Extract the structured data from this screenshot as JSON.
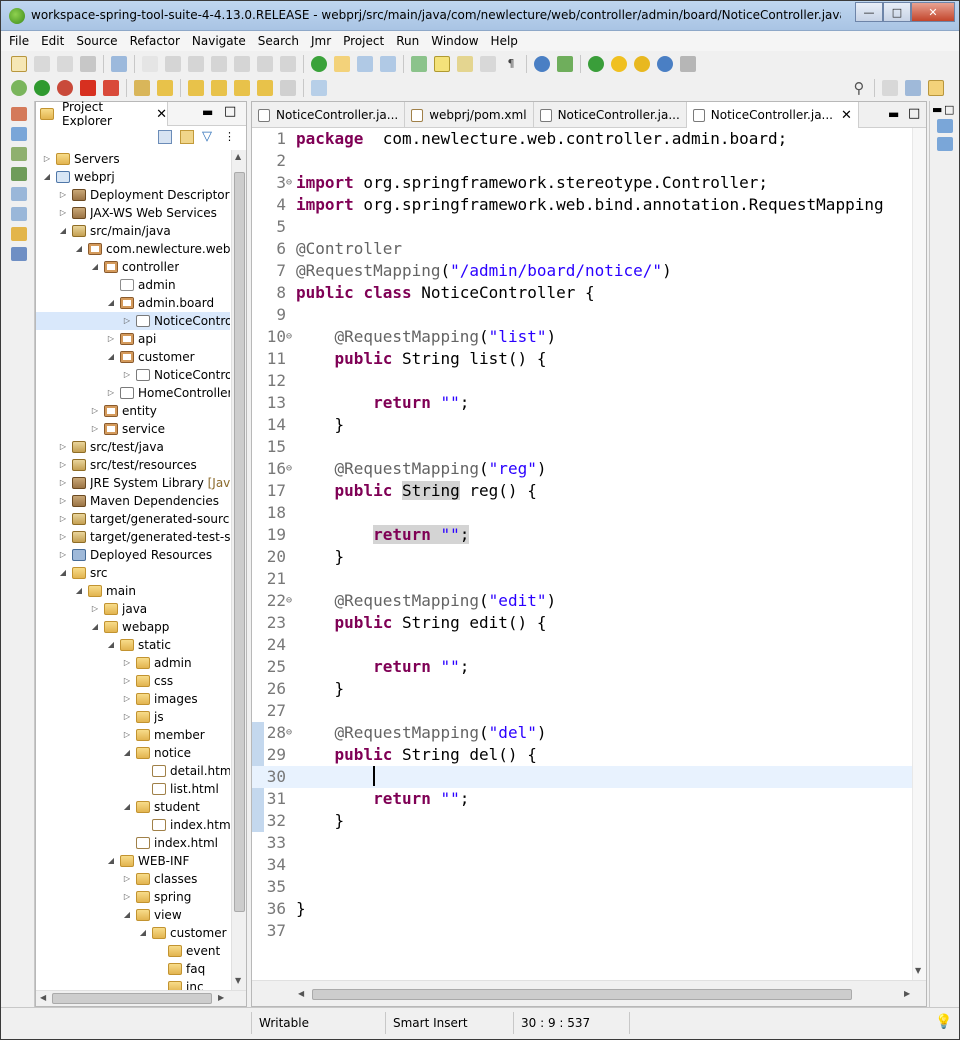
{
  "window": {
    "title": "workspace-spring-tool-suite-4-4.13.0.RELEASE - webprj/src/main/java/com/newlecture/web/controller/admin/board/NoticeController.java - Spring To...",
    "min_label": "—",
    "max_label": "□",
    "close_label": "✕"
  },
  "menu": [
    "File",
    "Edit",
    "Source",
    "Refactor",
    "Navigate",
    "Search",
    "Jmr",
    "Project",
    "Run",
    "Window",
    "Help"
  ],
  "explorer": {
    "tab_label": "Project Explorer",
    "tree": [
      {
        "label": "Servers",
        "indent": 0,
        "tw": "▷",
        "icon": "folder"
      },
      {
        "label": "webprj",
        "indent": 0,
        "tw": "◢",
        "icon": "proj"
      },
      {
        "label": "Deployment Descriptor: w",
        "indent": 1,
        "tw": "▷",
        "icon": "jar"
      },
      {
        "label": "JAX-WS Web Services",
        "indent": 1,
        "tw": "▷",
        "icon": "jar"
      },
      {
        "label": "src/main/java",
        "indent": 1,
        "tw": "◢",
        "icon": "srcf"
      },
      {
        "label": "com.newlecture.web",
        "indent": 2,
        "tw": "◢",
        "icon": "pkg"
      },
      {
        "label": "controller",
        "indent": 3,
        "tw": "◢",
        "icon": "pkg"
      },
      {
        "label": "admin",
        "indent": 4,
        "tw": "",
        "icon": "pkgempty"
      },
      {
        "label": "admin.board",
        "indent": 4,
        "tw": "◢",
        "icon": "pkg"
      },
      {
        "label": "NoticeControl",
        "indent": 5,
        "tw": "▷",
        "icon": "java",
        "selected": true
      },
      {
        "label": "api",
        "indent": 4,
        "tw": "▷",
        "icon": "pkg"
      },
      {
        "label": "customer",
        "indent": 4,
        "tw": "◢",
        "icon": "pkg"
      },
      {
        "label": "NoticeControl",
        "indent": 5,
        "tw": "▷",
        "icon": "java"
      },
      {
        "label": "HomeController.j",
        "indent": 4,
        "tw": "▷",
        "icon": "java"
      },
      {
        "label": "entity",
        "indent": 3,
        "tw": "▷",
        "icon": "pkg"
      },
      {
        "label": "service",
        "indent": 3,
        "tw": "▷",
        "icon": "pkg"
      },
      {
        "label": "src/test/java",
        "indent": 1,
        "tw": "▷",
        "icon": "srcf"
      },
      {
        "label": "src/test/resources",
        "indent": 1,
        "tw": "▷",
        "icon": "srcf"
      },
      {
        "label": "JRE System Library [JavaSE",
        "indent": 1,
        "tw": "▷",
        "icon": "jar",
        "muted_suffix": "[JavaSE"
      },
      {
        "label": "Maven Dependencies",
        "indent": 1,
        "tw": "▷",
        "icon": "jar"
      },
      {
        "label": "target/generated-sources/",
        "indent": 1,
        "tw": "▷",
        "icon": "srcf"
      },
      {
        "label": "target/generated-test-sour",
        "indent": 1,
        "tw": "▷",
        "icon": "srcf"
      },
      {
        "label": "Deployed Resources",
        "indent": 1,
        "tw": "▷",
        "icon": "server"
      },
      {
        "label": "src",
        "indent": 1,
        "tw": "◢",
        "icon": "folder"
      },
      {
        "label": "main",
        "indent": 2,
        "tw": "◢",
        "icon": "folder"
      },
      {
        "label": "java",
        "indent": 3,
        "tw": "▷",
        "icon": "folder"
      },
      {
        "label": "webapp",
        "indent": 3,
        "tw": "◢",
        "icon": "folder"
      },
      {
        "label": "static",
        "indent": 4,
        "tw": "◢",
        "icon": "folder"
      },
      {
        "label": "admin",
        "indent": 5,
        "tw": "▷",
        "icon": "folder"
      },
      {
        "label": "css",
        "indent": 5,
        "tw": "▷",
        "icon": "folder"
      },
      {
        "label": "images",
        "indent": 5,
        "tw": "▷",
        "icon": "folder"
      },
      {
        "label": "js",
        "indent": 5,
        "tw": "▷",
        "icon": "folder"
      },
      {
        "label": "member",
        "indent": 5,
        "tw": "▷",
        "icon": "folder"
      },
      {
        "label": "notice",
        "indent": 5,
        "tw": "◢",
        "icon": "folder"
      },
      {
        "label": "detail.html",
        "indent": 6,
        "tw": "",
        "icon": "html"
      },
      {
        "label": "list.html",
        "indent": 6,
        "tw": "",
        "icon": "html"
      },
      {
        "label": "student",
        "indent": 5,
        "tw": "◢",
        "icon": "folder"
      },
      {
        "label": "index.html",
        "indent": 6,
        "tw": "",
        "icon": "html"
      },
      {
        "label": "index.html",
        "indent": 5,
        "tw": "",
        "icon": "html"
      },
      {
        "label": "WEB-INF",
        "indent": 4,
        "tw": "◢",
        "icon": "folder"
      },
      {
        "label": "classes",
        "indent": 5,
        "tw": "▷",
        "icon": "folder"
      },
      {
        "label": "spring",
        "indent": 5,
        "tw": "▷",
        "icon": "folder"
      },
      {
        "label": "view",
        "indent": 5,
        "tw": "◢",
        "icon": "folder"
      },
      {
        "label": "customer",
        "indent": 6,
        "tw": "◢",
        "icon": "folder"
      },
      {
        "label": "event",
        "indent": 7,
        "tw": "",
        "icon": "folder"
      },
      {
        "label": "faq",
        "indent": 7,
        "tw": "",
        "icon": "folder"
      },
      {
        "label": "inc",
        "indent": 7,
        "tw": "",
        "icon": "folder"
      }
    ]
  },
  "editor": {
    "tabs": [
      {
        "label": "NoticeController.ja...",
        "icon": "java"
      },
      {
        "label": "webprj/pom.xml",
        "icon": "xml"
      },
      {
        "label": "NoticeController.ja...",
        "icon": "java"
      },
      {
        "label": "NoticeController.ja...",
        "icon": "java",
        "active": true,
        "closable": true
      }
    ],
    "close_glyph": "✕",
    "fold_glyph": "⊖",
    "current_line": 30,
    "lines": [
      {
        "n": "1",
        "tokens": [
          [
            "kw",
            "package"
          ],
          [
            "",
            "  com.newlecture.web.controller.admin.board;"
          ]
        ]
      },
      {
        "n": "2",
        "tokens": []
      },
      {
        "n": "3",
        "fold": true,
        "tokens": [
          [
            "kw",
            "import"
          ],
          [
            "",
            " org.springframework.stereotype.Controller;"
          ]
        ]
      },
      {
        "n": "4",
        "tokens": [
          [
            "kw",
            "import"
          ],
          [
            "",
            " org.springframework.web.bind.annotation.RequestMapping"
          ]
        ]
      },
      {
        "n": "5",
        "tokens": []
      },
      {
        "n": "6",
        "tokens": [
          [
            "an",
            "@Controller"
          ]
        ]
      },
      {
        "n": "7",
        "tokens": [
          [
            "an",
            "@RequestMapping"
          ],
          [
            "",
            "("
          ],
          [
            "st",
            "\"/admin/board/notice/\""
          ],
          [
            "",
            ")"
          ]
        ]
      },
      {
        "n": "8",
        "tokens": [
          [
            "kw",
            "public"
          ],
          [
            "",
            " "
          ],
          [
            "kw",
            "class"
          ],
          [
            "",
            " NoticeController {"
          ]
        ]
      },
      {
        "n": "9",
        "tokens": []
      },
      {
        "n": "10",
        "fold": true,
        "tokens": [
          [
            "",
            "    "
          ],
          [
            "an",
            "@RequestMapping"
          ],
          [
            "",
            "("
          ],
          [
            "st",
            "\"list\""
          ],
          [
            "",
            ")"
          ]
        ]
      },
      {
        "n": "11",
        "tokens": [
          [
            "",
            "    "
          ],
          [
            "kw",
            "public"
          ],
          [
            "",
            " String list() {"
          ]
        ]
      },
      {
        "n": "12",
        "tokens": []
      },
      {
        "n": "13",
        "tokens": [
          [
            "",
            "        "
          ],
          [
            "kw",
            "return"
          ],
          [
            "",
            " "
          ],
          [
            "st",
            "\"\""
          ],
          [
            "",
            ";"
          ]
        ]
      },
      {
        "n": "14",
        "tokens": [
          [
            "",
            "    }"
          ]
        ]
      },
      {
        "n": "15",
        "tokens": []
      },
      {
        "n": "16",
        "fold": true,
        "tokens": [
          [
            "",
            "    "
          ],
          [
            "an",
            "@RequestMapping"
          ],
          [
            "",
            "("
          ],
          [
            "st",
            "\"reg\""
          ],
          [
            "",
            ")"
          ]
        ]
      },
      {
        "n": "17",
        "tokens": [
          [
            "",
            "    "
          ],
          [
            "kw",
            "public"
          ],
          [
            "",
            " "
          ],
          [
            "hl",
            "String"
          ],
          [
            "",
            " reg() {"
          ]
        ]
      },
      {
        "n": "18",
        "tokens": []
      },
      {
        "n": "19",
        "tokens": [
          [
            "",
            "        "
          ],
          [
            "kw hl",
            "return"
          ],
          [
            "hl",
            " "
          ],
          [
            "st hl",
            "\"\""
          ],
          [
            "hl",
            ";"
          ]
        ]
      },
      {
        "n": "20",
        "tokens": [
          [
            "",
            "    }"
          ]
        ]
      },
      {
        "n": "21",
        "tokens": []
      },
      {
        "n": "22",
        "fold": true,
        "tokens": [
          [
            "",
            "    "
          ],
          [
            "an",
            "@RequestMapping"
          ],
          [
            "",
            "("
          ],
          [
            "st",
            "\"edit\""
          ],
          [
            "",
            ")"
          ]
        ]
      },
      {
        "n": "23",
        "tokens": [
          [
            "",
            "    "
          ],
          [
            "kw",
            "public"
          ],
          [
            "",
            " String edit() {"
          ]
        ]
      },
      {
        "n": "24",
        "tokens": []
      },
      {
        "n": "25",
        "tokens": [
          [
            "",
            "        "
          ],
          [
            "kw",
            "return"
          ],
          [
            "",
            " "
          ],
          [
            "st",
            "\"\""
          ],
          [
            "",
            ";"
          ]
        ]
      },
      {
        "n": "26",
        "tokens": [
          [
            "",
            "    }"
          ]
        ]
      },
      {
        "n": "27",
        "tokens": []
      },
      {
        "n": "28",
        "fold": true,
        "tokens": [
          [
            "",
            "    "
          ],
          [
            "an",
            "@RequestMapping"
          ],
          [
            "",
            "("
          ],
          [
            "st",
            "\"del\""
          ],
          [
            "",
            ")"
          ]
        ]
      },
      {
        "n": "29",
        "tokens": [
          [
            "",
            "    "
          ],
          [
            "kw",
            "public"
          ],
          [
            "",
            " String del() {"
          ]
        ]
      },
      {
        "n": "30",
        "caret": true,
        "tokens": [
          [
            "",
            "        "
          ]
        ]
      },
      {
        "n": "31",
        "tokens": [
          [
            "",
            "        "
          ],
          [
            "kw",
            "return"
          ],
          [
            "",
            " "
          ],
          [
            "st",
            "\"\""
          ],
          [
            "",
            ";"
          ]
        ]
      },
      {
        "n": "32",
        "tokens": [
          [
            "",
            "    }"
          ]
        ]
      },
      {
        "n": "33",
        "tokens": []
      },
      {
        "n": "34",
        "tokens": []
      },
      {
        "n": "35",
        "tokens": []
      },
      {
        "n": "36",
        "tokens": [
          [
            "",
            "}"
          ]
        ]
      },
      {
        "n": "37",
        "tokens": []
      }
    ]
  },
  "status": {
    "writable": "Writable",
    "insert_mode": "Smart Insert",
    "position": "30 : 9 : 537"
  },
  "colors": {
    "keyword": "#7f0055",
    "annotation": "#646464",
    "string": "#2a00ff",
    "current_line": "#e8f2fe"
  }
}
